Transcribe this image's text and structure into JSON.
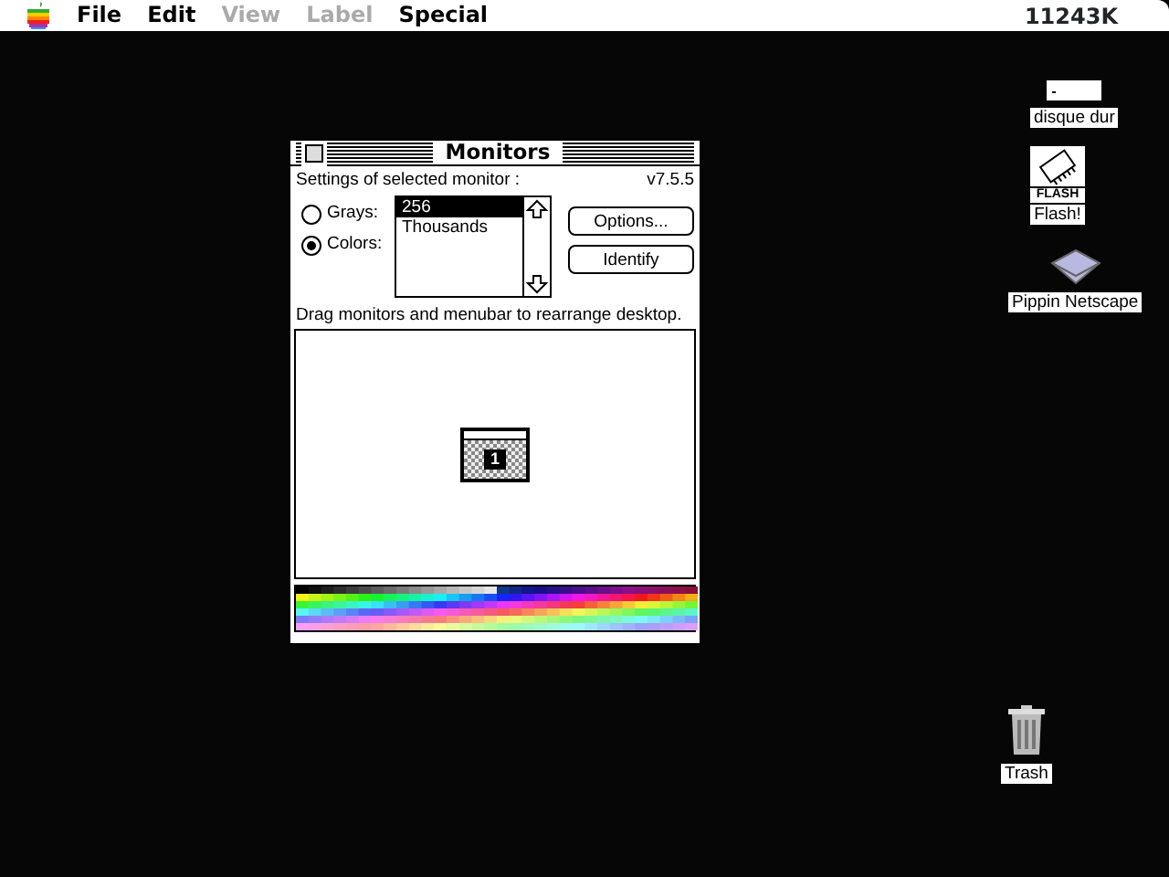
{
  "menubar": {
    "menus": [
      {
        "label": "File",
        "disabled": false
      },
      {
        "label": "Edit",
        "disabled": false
      },
      {
        "label": "View",
        "disabled": true
      },
      {
        "label": "Label",
        "disabled": true
      },
      {
        "label": "Special",
        "disabled": false
      }
    ],
    "memory": "11243K"
  },
  "window": {
    "title": "Monitors",
    "heading": "Settings of selected monitor :",
    "version": "v7.5.5",
    "modes": [
      {
        "label": "Grays:",
        "selected": false
      },
      {
        "label": "Colors:",
        "selected": true
      }
    ],
    "depths": [
      {
        "label": "256",
        "selected": true
      },
      {
        "label": "Thousands",
        "selected": false
      }
    ],
    "buttons": [
      "Options...",
      "Identify"
    ],
    "arrange_hint": "Drag monitors and menubar to rearrange desktop.",
    "monitor": {
      "number": "1"
    }
  },
  "desktop_icons": [
    {
      "kind": "disk",
      "label": "disque dur"
    },
    {
      "kind": "flash",
      "label": "Flash!",
      "badge": "FLASH"
    },
    {
      "kind": "cd",
      "label": "Pippin Netscape"
    },
    {
      "kind": "trash",
      "label": "Trash"
    }
  ]
}
